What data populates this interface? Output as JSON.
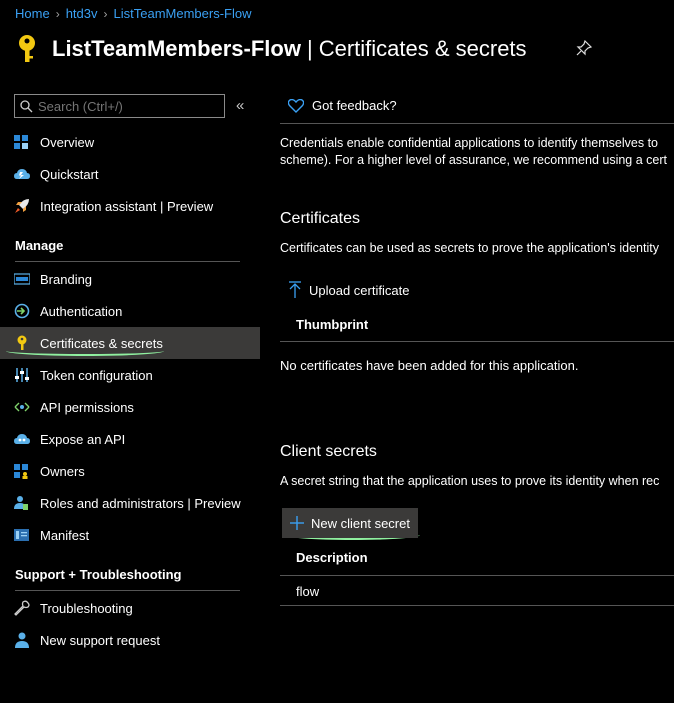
{
  "breadcrumb": {
    "items": [
      "Home",
      "htd3v",
      "ListTeamMembers-Flow"
    ],
    "separator": "›"
  },
  "header": {
    "title": "ListTeamMembers-Flow",
    "separator": "|",
    "subtitle": "Certificates & secrets",
    "icon": "key-icon",
    "pin_icon": "pin-icon"
  },
  "sidebar": {
    "search_placeholder": "Search (Ctrl+/)",
    "collapse_label": "«",
    "items_top": [
      {
        "label": "Overview",
        "icon": "overview-icon"
      },
      {
        "label": "Quickstart",
        "icon": "quickstart-icon"
      },
      {
        "label": "Integration assistant | Preview",
        "icon": "rocket-icon"
      }
    ],
    "section_manage": "Manage",
    "items_manage": [
      {
        "label": "Branding",
        "icon": "branding-icon"
      },
      {
        "label": "Authentication",
        "icon": "authentication-icon"
      },
      {
        "label": "Certificates & secrets",
        "icon": "key-icon",
        "active": true
      },
      {
        "label": "Token configuration",
        "icon": "token-config-icon"
      },
      {
        "label": "API permissions",
        "icon": "api-permissions-icon"
      },
      {
        "label": "Expose an API",
        "icon": "cloud-icon"
      },
      {
        "label": "Owners",
        "icon": "owners-icon"
      },
      {
        "label": "Roles and administrators | Preview",
        "icon": "roles-icon"
      },
      {
        "label": "Manifest",
        "icon": "manifest-icon"
      }
    ],
    "section_support": "Support + Troubleshooting",
    "items_support": [
      {
        "label": "Troubleshooting",
        "icon": "wrench-icon"
      },
      {
        "label": "New support request",
        "icon": "support-person-icon"
      }
    ]
  },
  "main": {
    "feedback_label": "Got feedback?",
    "intro_line1": "Credentials enable confidential applications to identify themselves to",
    "intro_line2": "scheme). For a higher level of assurance, we recommend using a cert",
    "certificates": {
      "heading": "Certificates",
      "description": "Certificates can be used as secrets to prove the application's identity",
      "upload_label": "Upload certificate",
      "column_thumbprint": "Thumbprint",
      "empty_message": "No certificates have been added for this application."
    },
    "client_secrets": {
      "heading": "Client secrets",
      "description": "A secret string that the application uses to prove its identity when rec",
      "new_secret_label": "New client secret",
      "column_description": "Description",
      "rows": [
        "flow"
      ]
    }
  },
  "colors": {
    "background": "#000000",
    "link": "#3aa0f3",
    "key_yellow": "#f2c811",
    "active_bg": "#3b3a39",
    "highlight_underline": "#90f0a0"
  }
}
